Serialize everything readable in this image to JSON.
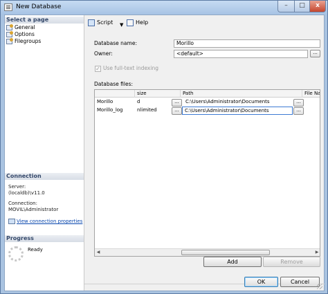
{
  "window": {
    "title": "New Database",
    "close_glyph": "x",
    "maximize_glyph": "□",
    "minimize_glyph": "–"
  },
  "left": {
    "select_page_header": "Select a page",
    "pages": [
      "General",
      "Options",
      "Filegroups"
    ],
    "connection_header": "Connection",
    "server_label": "Server:",
    "server_value": "(localdb)\\v11.0",
    "connection_label": "Connection:",
    "connection_value": "MOVIL\\Administrator",
    "view_link": "View connection properties",
    "progress_header": "Progress",
    "progress_status": "Ready"
  },
  "toolbar": {
    "script_label": "Script",
    "help_label": "Help",
    "dropdown_glyph": "▼"
  },
  "form": {
    "db_name_label": "Database name:",
    "db_name_value": "Morillo",
    "owner_label": "Owner:",
    "owner_value": "<default>",
    "ellipsis": "...",
    "fulltext_label": "Use full-text indexing",
    "fulltext_checked": true,
    "check_glyph": "✓",
    "files_label": "Database files:"
  },
  "files_grid": {
    "columns": [
      "size",
      "Path",
      "File Nam"
    ],
    "rows": [
      {
        "name": "Morillo",
        "size": "d",
        "path": "C:\\Users\\Administrator\\Documents"
      },
      {
        "name": "Morillo_log",
        "size": "nlimited",
        "path": "C:\\Users\\Administrator\\Documents"
      }
    ],
    "scroll_left": "◀",
    "scroll_right": "▶"
  },
  "buttons": {
    "add": "Add",
    "remove": "Remove",
    "ok": "OK",
    "cancel": "Cancel"
  },
  "colors": {
    "title_bar": "#b5cde9",
    "close_button": "#c9482f",
    "link": "#0645ad",
    "selection_border": "#3d7bd4"
  }
}
